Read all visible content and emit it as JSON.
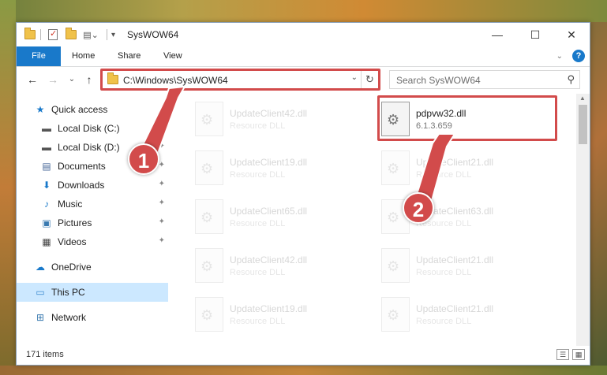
{
  "window": {
    "title": "SysWOW64",
    "min_glyph": "—",
    "max_glyph": "☐",
    "close_glyph": "✕"
  },
  "ribbon": {
    "tabs": [
      "File",
      "Home",
      "Share",
      "View"
    ],
    "expand_glyph": "⌄",
    "help_glyph": "?"
  },
  "nav": {
    "back_glyph": "←",
    "forward_glyph": "→",
    "recent_glyph": "⌄",
    "up_glyph": "↑",
    "address": "C:\\Windows\\SysWOW64",
    "address_dd_glyph": "⌄",
    "refresh_glyph": "↻",
    "search_placeholder": "Search SysWOW64",
    "search_glyph": "⚲"
  },
  "sidebar": {
    "items": [
      {
        "label": "Quick access",
        "icon": "star-icon",
        "glyph": "★",
        "color": "#1979ca",
        "pinned": false
      },
      {
        "label": "Local Disk (C:)",
        "icon": "drive-icon",
        "glyph": "▬",
        "color": "#555",
        "pinned": true
      },
      {
        "label": "Local Disk (D:)",
        "icon": "drive-icon",
        "glyph": "▬",
        "color": "#555",
        "pinned": true
      },
      {
        "label": "Documents",
        "icon": "document-icon",
        "glyph": "▤",
        "color": "#4a6a9a",
        "pinned": true
      },
      {
        "label": "Downloads",
        "icon": "download-icon",
        "glyph": "⬇",
        "color": "#1979ca",
        "pinned": true
      },
      {
        "label": "Music",
        "icon": "music-icon",
        "glyph": "♪",
        "color": "#1979ca",
        "pinned": true
      },
      {
        "label": "Pictures",
        "icon": "pictures-icon",
        "glyph": "▣",
        "color": "#3a7ab0",
        "pinned": true
      },
      {
        "label": "Videos",
        "icon": "video-icon",
        "glyph": "▦",
        "color": "#444",
        "pinned": true
      },
      {
        "label": "OneDrive",
        "icon": "cloud-icon",
        "glyph": "☁",
        "color": "#1979ca",
        "pinned": false
      },
      {
        "label": "This PC",
        "icon": "computer-icon",
        "glyph": "▭",
        "color": "#3a8ad0",
        "pinned": false
      },
      {
        "label": "Network",
        "icon": "network-icon",
        "glyph": "⊞",
        "color": "#3a7ab0",
        "pinned": false
      }
    ],
    "pin_glyph": "📌"
  },
  "files": {
    "highlighted": {
      "name": "pdpvw32.dll",
      "sub": "6.1.3.659"
    },
    "left_column": [
      {
        "name": "UpdateClient42.dll",
        "sub": "Resource DLL"
      },
      {
        "name": "UpdateClient19.dll",
        "sub": "Resource DLL"
      },
      {
        "name": "UpdateClient65.dll",
        "sub": "Resource DLL"
      },
      {
        "name": "UpdateClient42.dll",
        "sub": "Resource DLL"
      },
      {
        "name": "UpdateClient19.dll",
        "sub": "Resource DLL"
      }
    ],
    "right_column": [
      {
        "name": "UpdateClient21.dll",
        "sub": "Resource DLL"
      },
      {
        "name": "UpdateClient63.dll",
        "sub": "Resource DLL"
      },
      {
        "name": "UpdateClient21.dll",
        "sub": "Resource DLL"
      },
      {
        "name": "UpdateClient21.dll",
        "sub": "Resource DLL"
      }
    ]
  },
  "status": {
    "count": "171 items"
  },
  "callouts": [
    "1",
    "2"
  ],
  "colors": {
    "accent": "#1979ca",
    "highlight": "#d24b4b",
    "selected": "#cce8ff"
  }
}
